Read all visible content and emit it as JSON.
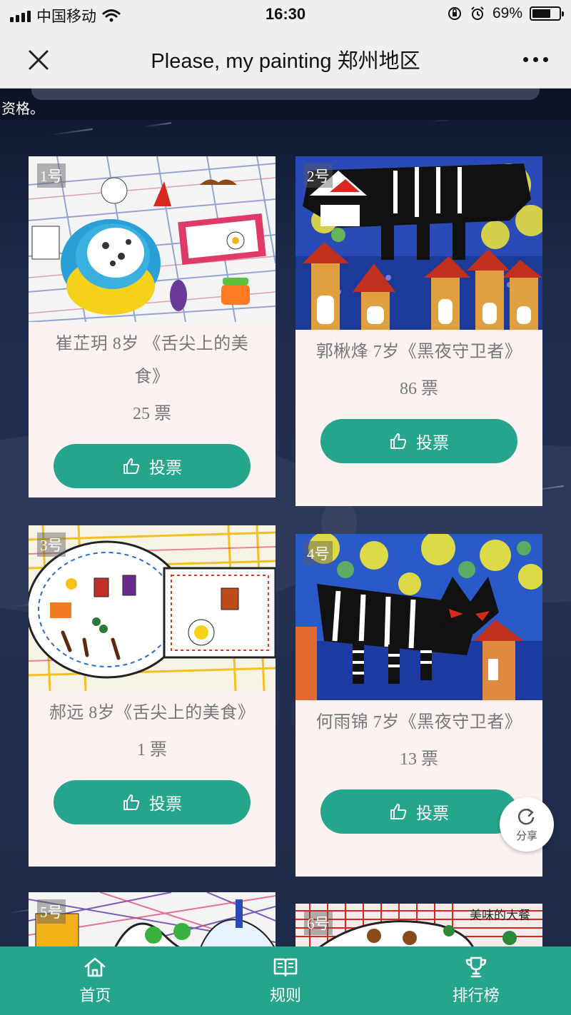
{
  "status_bar": {
    "carrier": "中国移动",
    "time": "16:30",
    "battery": "69%",
    "battery_level": 0.69
  },
  "nav": {
    "title": "Please, my painting 郑州地区"
  },
  "top_strip": {
    "text": "资格。"
  },
  "vote_label": "投票",
  "entries": [
    {
      "number": "1号",
      "title": "崔芷玥 8岁 《舌尖上的美食》",
      "votes": "25 票"
    },
    {
      "number": "2号",
      "title": "郭楸烽 7岁《黑夜守卫者》",
      "votes": "86 票"
    },
    {
      "number": "3号",
      "title": "郝远 8岁《舌尖上的美食》",
      "votes": "1 票"
    },
    {
      "number": "4号",
      "title": "何雨锦 7岁《黑夜守卫者》",
      "votes": "13 票"
    },
    {
      "number": "5号"
    },
    {
      "number": "6号",
      "painting_text": "美味的大餐"
    }
  ],
  "share_label": "分享",
  "tabs": [
    {
      "label": "首页",
      "icon": "home-icon"
    },
    {
      "label": "规则",
      "icon": "book-icon"
    },
    {
      "label": "排行榜",
      "icon": "trophy-icon"
    }
  ],
  "colors": {
    "accent": "#25a68c",
    "card_bg": "#fdf2f2",
    "page_bg": "#1c2742"
  }
}
